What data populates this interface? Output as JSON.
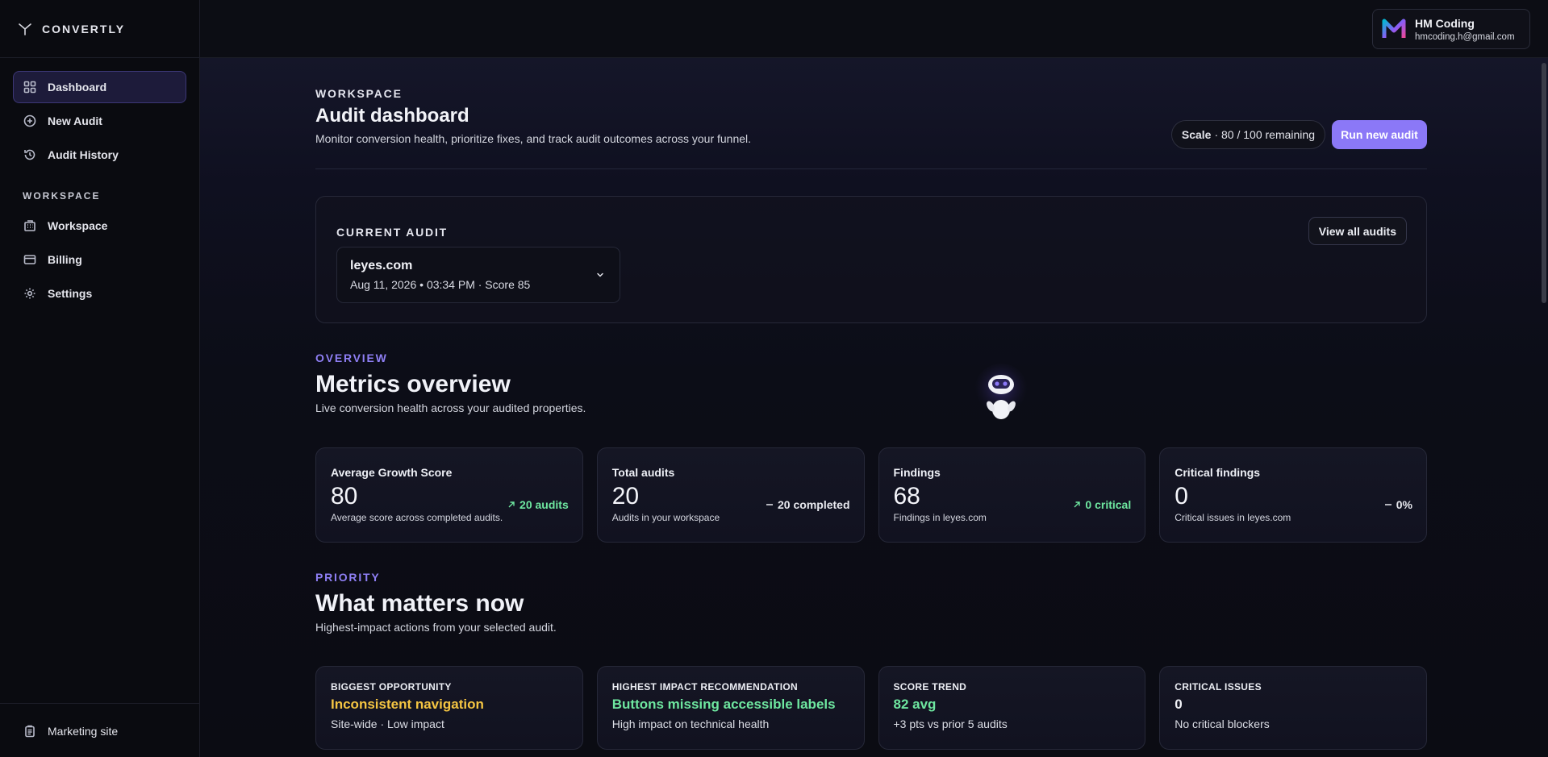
{
  "brand": {
    "name": "CONVERTLY",
    "icon": "convertly-logo-icon"
  },
  "sidebar": {
    "items": [
      {
        "label": "Dashboard",
        "icon": "grid-icon",
        "active": true
      },
      {
        "label": "New Audit",
        "icon": "plus-circle-icon"
      },
      {
        "label": "Audit History",
        "icon": "history-icon"
      }
    ],
    "section_label": "WORKSPACE",
    "workspace_items": [
      {
        "label": "Workspace",
        "icon": "building-icon"
      },
      {
        "label": "Billing",
        "icon": "card-icon"
      },
      {
        "label": "Settings",
        "icon": "gear-icon"
      }
    ],
    "footer": {
      "label": "Marketing site",
      "icon": "clipboard-icon"
    }
  },
  "user": {
    "name": "HM Coding",
    "email": "hmcoding.h@gmail.com",
    "logo": "m-logo-icon",
    "logo_colors": [
      "#8b5cf6",
      "#ec4899",
      "#06b6d4"
    ]
  },
  "header": {
    "eyebrow": "WORKSPACE",
    "title": "Audit dashboard",
    "subtitle": "Monitor conversion health, prioritize fixes, and track audit outcomes across your funnel.",
    "plan_name": "Scale",
    "plan_remaining": "· 80 / 100 remaining",
    "run_button": "Run new audit"
  },
  "current_audit": {
    "eyebrow": "CURRENT AUDIT",
    "view_all": "View all audits",
    "domain": "leyes.com",
    "meta": "Aug 11, 2026 • 03:34 PM  ·  Score 85"
  },
  "overview": {
    "eyebrow": "OVERVIEW",
    "title": "Metrics overview",
    "subtitle": "Live conversion health across your audited properties.",
    "metrics": [
      {
        "label": "Average Growth Score",
        "value": "80",
        "desc": "Average score across completed audits.",
        "delta": "20 audits",
        "delta_style": "green",
        "delta_icon": "arrow-up-right-icon"
      },
      {
        "label": "Total audits",
        "value": "20",
        "desc": "Audits in your workspace",
        "delta": "20 completed",
        "delta_style": "neutral",
        "delta_icon": "dash-icon"
      },
      {
        "label": "Findings",
        "value": "68",
        "desc": "Findings in leyes.com",
        "delta": "0 critical",
        "delta_style": "green",
        "delta_icon": "arrow-up-right-icon"
      },
      {
        "label": "Critical findings",
        "value": "0",
        "desc": "Critical issues in leyes.com",
        "delta": "0%",
        "delta_style": "neutral",
        "delta_icon": "dash-icon"
      }
    ]
  },
  "priority": {
    "eyebrow": "PRIORITY",
    "title": "What matters now",
    "subtitle": "Highest-impact actions from your selected audit.",
    "cards": [
      {
        "label": "BIGGEST OPPORTUNITY",
        "value": "Inconsistent navigation",
        "desc": "Site-wide · Low impact",
        "color": "#f5c542"
      },
      {
        "label": "HIGHEST IMPACT RECOMMENDATION",
        "value": "Buttons missing accessible labels",
        "desc": "High impact on technical health",
        "color": "#6ee7a0"
      },
      {
        "label": "SCORE TREND",
        "value": "82 avg",
        "desc": "+3 pts vs prior 5 audits",
        "color": "#6ee7a0"
      },
      {
        "label": "CRITICAL ISSUES",
        "value": "0",
        "desc": "No critical blockers",
        "color": "#f1f2f7"
      }
    ]
  },
  "colors": {
    "accent": "#8b78f7",
    "positive": "#6ee7a0",
    "warning": "#f5c542"
  }
}
